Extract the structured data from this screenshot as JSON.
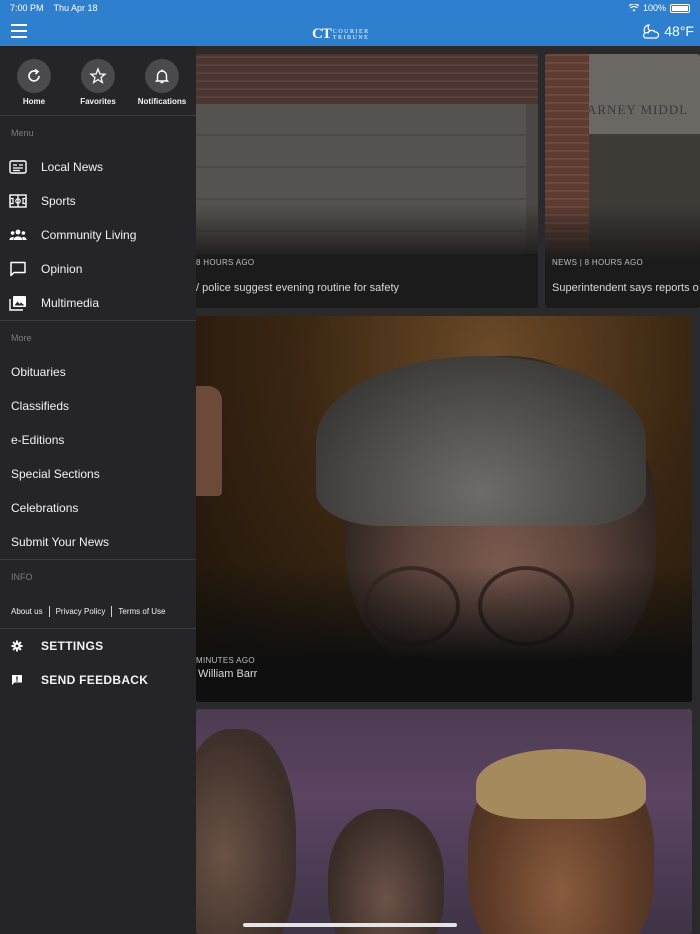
{
  "status_bar": {
    "time": "7:00 PM",
    "date": "Thu Apr 18",
    "battery": "100%"
  },
  "header": {
    "logo_mark": "CT",
    "logo_line1": "COURIER",
    "logo_line2": "TRIBUNE",
    "temperature": "48°F"
  },
  "drawer": {
    "quick_actions": [
      {
        "label": "Home",
        "icon": "home-refresh-icon"
      },
      {
        "label": "Favorites",
        "icon": "star-icon"
      },
      {
        "label": "Notifications",
        "icon": "bell-icon"
      }
    ],
    "menu_label": "Menu",
    "menu_items": [
      {
        "label": "Local News",
        "icon": "newspaper-icon"
      },
      {
        "label": "Sports",
        "icon": "sports-field-icon"
      },
      {
        "label": "Community Living",
        "icon": "people-icon"
      },
      {
        "label": "Opinion",
        "icon": "speech-bubble-icon"
      },
      {
        "label": "Multimedia",
        "icon": "photo-library-icon"
      }
    ],
    "more_label": "More",
    "more_items": [
      "Obituaries",
      "Classifieds",
      "e-Editions",
      "Special Sections",
      "Celebrations",
      "Submit Your News"
    ],
    "info_label": "INFO",
    "info_links": [
      "About us",
      "Privacy Policy",
      "Terms of Use"
    ],
    "settings_label": "SETTINGS",
    "feedback_label": "SEND FEEDBACK"
  },
  "content": {
    "cards": [
      {
        "meta": "8 HOURS AGO",
        "title": "/ police suggest evening routine for safety"
      },
      {
        "meta": "NEWS | 8 HOURS AGO",
        "title": "Superintendent says reports o",
        "sign": "ARNEY  MIDDL"
      },
      {
        "meta": "MINUTES AGO",
        "title": "William Barr"
      },
      {
        "meta": "",
        "title": ""
      }
    ]
  }
}
